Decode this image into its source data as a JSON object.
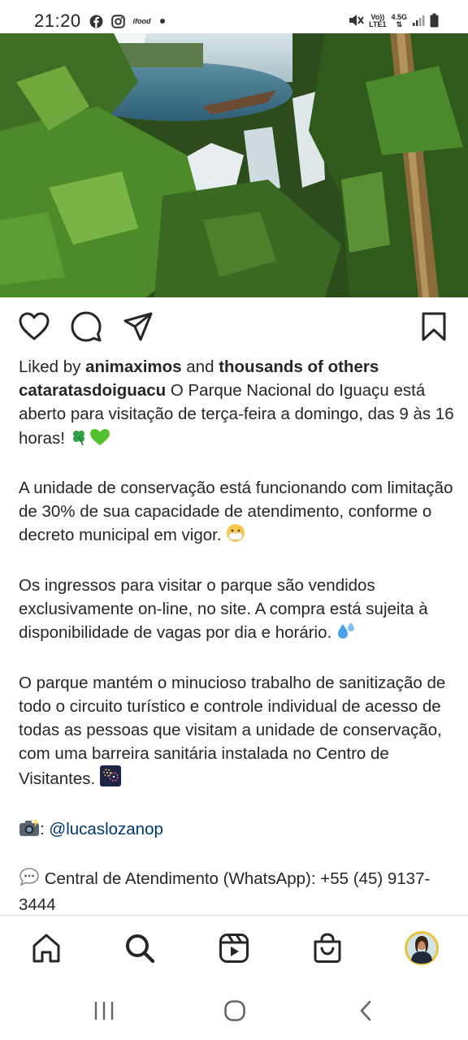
{
  "status_bar": {
    "time": "21:20",
    "app_icons": [
      "facebook-icon",
      "instagram-icon",
      "ifood-icon",
      "dot-icon"
    ],
    "ifood_label": "ifood",
    "volte_top": "Vo))",
    "volte_bottom": "LTE1",
    "network_type": "4.5G",
    "icons": [
      "mute-icon",
      "signal-icon",
      "battery-icon"
    ]
  },
  "post": {
    "photo_subject": "waterfall-forest-photo",
    "actions": [
      "like-icon",
      "comment-icon",
      "share-icon",
      "save-icon"
    ],
    "likes": {
      "prefix": "Liked by",
      "user": "animaximos",
      "middle": "and",
      "others": "thousands of others"
    },
    "caption": {
      "username": "cataratasdoiguacu",
      "p1": "O Parque Nacional do Iguaçu está aberto para visitação de terça-feira a domingo, das 9 às 16 horas!",
      "p2": "A unidade de conservação está funcionando com limitação de 30% de sua capacidade de atendimento, conforme o decreto municipal em vigor.",
      "p3": "Os ingressos para visitar o parque são vendidos exclusivamente on-line, no site. A compra está sujeita à disponibilidade de vagas por dia e horário.",
      "p4": "O parque mantém o minucioso trabalho de sanitização de todo o circuito turístico e controle individual de acesso de todas as pessoas que visitam a unidade de conservação, com uma barreira sanitária instalada no Centro de Visitantes.",
      "credit_sep": ":",
      "credit_mention": "@lucaslozanop",
      "contact": "Central de Atendimento (WhatsApp): +55 (45) 9137-3444"
    }
  },
  "bottom_nav": [
    "home-icon",
    "search-icon",
    "reels-icon",
    "shop-icon",
    "profile-avatar"
  ],
  "system_nav": [
    "recents-icon",
    "home-circle-icon",
    "back-icon"
  ],
  "colors": {
    "text": "#262626",
    "mention": "#00376b",
    "divider": "#dbdbdb"
  }
}
